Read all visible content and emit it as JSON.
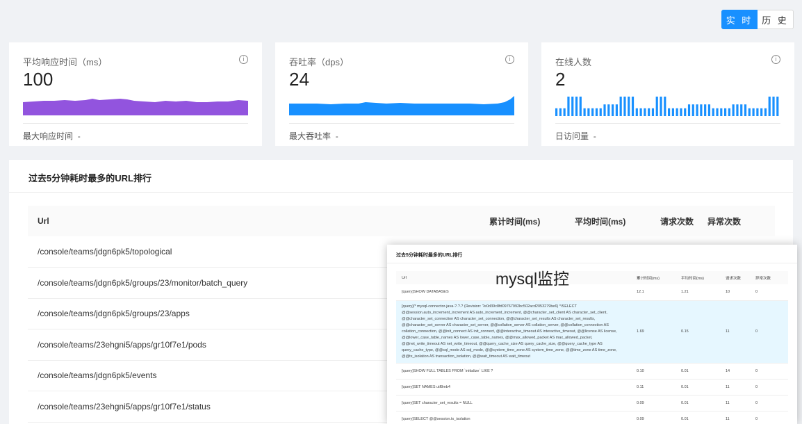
{
  "mode_toggle": {
    "realtime": "实 时",
    "history": "历 史"
  },
  "cards": [
    {
      "title": "平均响应时间（ms）",
      "value": "100",
      "footer_label": "最大响应时间",
      "footer_value": "-",
      "color": "#9254de"
    },
    {
      "title": "吞吐率（dps）",
      "value": "24",
      "footer_label": "最大吞吐率",
      "footer_value": "-",
      "color": "#1890ff"
    },
    {
      "title": "在线人数",
      "value": "2",
      "footer_label": "日访问量",
      "footer_value": "-",
      "color": "#1890ff"
    }
  ],
  "bars": [
    2,
    2,
    2,
    5,
    5,
    5,
    5,
    2,
    2,
    2,
    2,
    2,
    3,
    3,
    3,
    3,
    5,
    5,
    5,
    5,
    2,
    2,
    2,
    2,
    2,
    5,
    5,
    5,
    2,
    2,
    2,
    2,
    2,
    3,
    3,
    3,
    3,
    3,
    3,
    2,
    2,
    2,
    2,
    2,
    3,
    3,
    3,
    3,
    2,
    2,
    2,
    2,
    2,
    5,
    5,
    5
  ],
  "url_panel": {
    "title": "过去5分钟耗时最多的URL排行",
    "columns": [
      "Url",
      "累计时间(ms)",
      "平均时间(ms)",
      "请求次数",
      "异常次数"
    ],
    "rows": [
      "/console/teams/jdgn6pk5/topological",
      "/console/teams/jdgn6pk5/groups/23/monitor/batch_query",
      "/console/teams/jdgn6pk5/groups/23/apps",
      "/console/teams/23ehgni5/apps/gr10f7e1/pods",
      "/console/teams/jdgn6pk5/events",
      "/console/teams/23ehgni5/apps/gr10f7e1/status"
    ]
  },
  "overlay": {
    "title": "过去5分钟耗时最多的URL排行",
    "brand": "mysql监控",
    "columns": [
      "Url",
      "累计时间(ms)",
      "平均时间(ms)",
      "请求次数",
      "异常次数"
    ],
    "rows": [
      {
        "url": "[query]SHOW DATABASES",
        "total": "12.1",
        "avg": "1.21",
        "count": "10",
        "errors": "0"
      },
      {
        "url": "[query]/* mysql-connector-java-?.?.? (Revision: ?e0d39c8fd09767992bc502acd2053279be6) */SELECT @@session.auto_increment_increment AS auto_increment_increment, @@character_set_client AS character_set_client, @@character_set_connection AS character_set_connection, @@character_set_results AS character_set_results, @@character_set_server AS character_set_server, @@collation_server AS collation_server, @@collation_connection AS collation_connection, @@init_connect AS init_connect, @@interactive_timeout AS interactive_timeout, @@license AS license, @@lower_case_table_names AS lower_case_table_names, @@max_allowed_packet AS max_allowed_packet, @@net_write_timeout AS net_write_timeout, @@query_cache_size AS query_cache_size, @@query_cache_type AS query_cache_type, @@sql_mode AS sql_mode, @@system_time_zone AS system_time_zone, @@time_zone AS time_zone, @@tx_isolation AS transaction_isolation, @@wait_timeout AS wait_timeout",
        "total": "1.69",
        "avg": "0.15",
        "count": "11",
        "errors": "0",
        "highlight": true
      },
      {
        "url": "[query]SHOW FULL TABLES FROM `initialize` LIKE ?",
        "total": "0.10",
        "avg": "0.01",
        "count": "14",
        "errors": "0"
      },
      {
        "url": "[query]SET NAMES utf8mb4",
        "total": "0.11",
        "avg": "0.01",
        "count": "11",
        "errors": "0"
      },
      {
        "url": "[query]SET character_set_results = NULL",
        "total": "0.09",
        "avg": "0.01",
        "count": "11",
        "errors": "0"
      },
      {
        "url": "[query]SELECT @@session.tx_isolation",
        "total": "0.09",
        "avg": "0.01",
        "count": "11",
        "errors": "0"
      }
    ]
  }
}
